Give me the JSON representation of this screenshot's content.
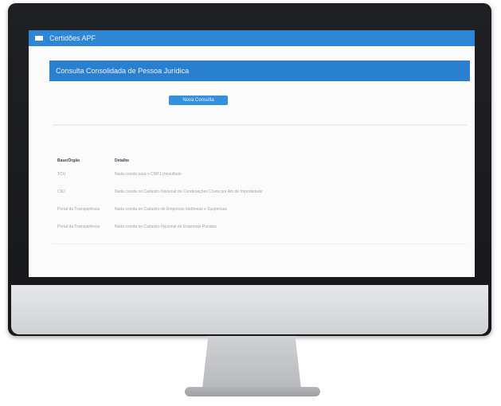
{
  "app": {
    "title": "Certidões APF",
    "logo_icon": "app-logo-icon"
  },
  "section": {
    "title": "Consulta Consolidada de Pessoa Jurídica"
  },
  "actions": {
    "button_label": "Nova Consulta"
  },
  "table": {
    "columns": [
      "Base/Órgão",
      "Detalhe"
    ],
    "rows": [
      {
        "base": "TCU",
        "detalhe": "Nada consta para o CNPJ consultado"
      },
      {
        "base": "CNJ",
        "detalhe": "Nada consta no Cadastro Nacional de Condenações Cíveis por Ato de Improbidade"
      },
      {
        "base": "Portal da Transparência",
        "detalhe": "Nada consta no Cadastro de Empresas Inidôneas e Suspensas"
      },
      {
        "base": "Portal da Transparência",
        "detalhe": "Nada consta no Cadastro Nacional de Empresas Punidas"
      }
    ]
  },
  "colors": {
    "accent": "#2e86d4",
    "header": "#2b7fcf",
    "bezel": "#1f2024"
  }
}
